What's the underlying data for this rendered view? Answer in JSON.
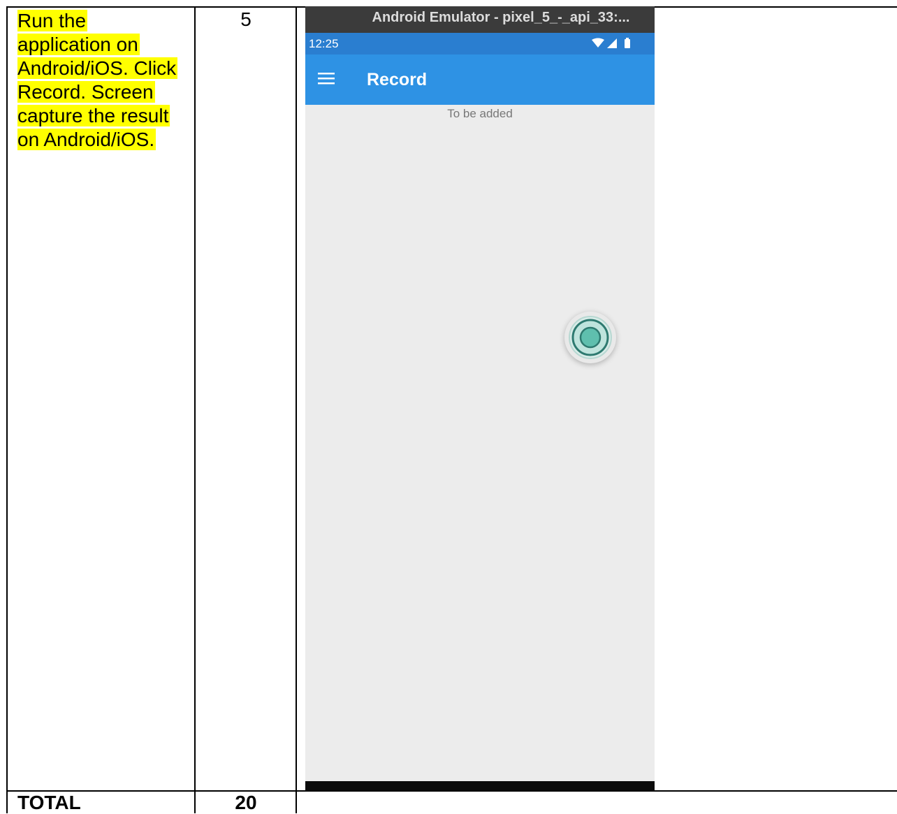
{
  "instruction": {
    "lines": [
      "Run the",
      "application on",
      "Android/iOS. Click",
      "Record. Screen",
      "capture the result",
      "on Android/iOS."
    ]
  },
  "marks": "5",
  "total": {
    "label": "TOTAL",
    "value": "20"
  },
  "emulator": {
    "window_title": "Android Emulator - pixel_5_-_api_33:...",
    "status": {
      "time": "12:25",
      "icons": [
        "wifi-icon",
        "signal-icon",
        "battery-icon"
      ]
    },
    "appbar": {
      "title": "Record",
      "menu_icon": "hamburger-menu-icon"
    },
    "content_text": "To be added",
    "record_button_icon": "record-icon",
    "colors": {
      "appbar": "#2e92e4",
      "statusbar": "#2a7ed0",
      "record_ring": "#2e7a70",
      "record_fill": "#5fbfae"
    }
  }
}
